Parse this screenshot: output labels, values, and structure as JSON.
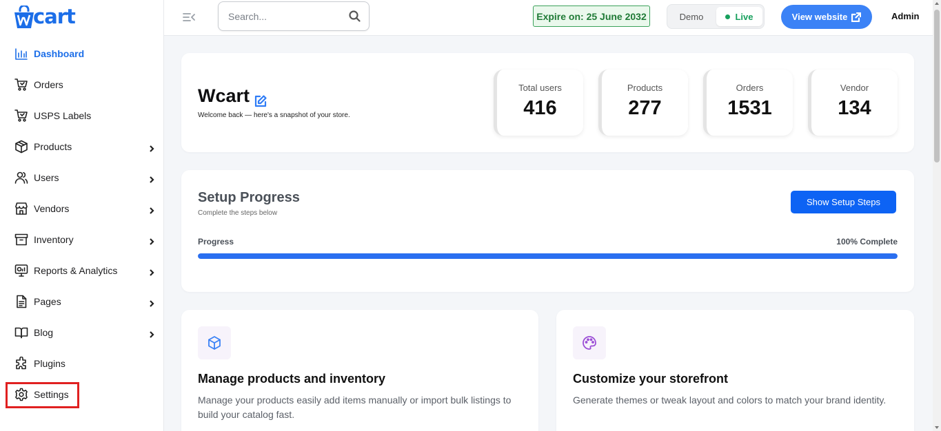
{
  "brand": {
    "name": "cart",
    "accent": "#1c6ee8"
  },
  "sidebar": {
    "items": [
      {
        "label": "Dashboard",
        "icon": "bar-chart-icon",
        "active": true,
        "has_submenu": false
      },
      {
        "label": "Orders",
        "icon": "cart-icon",
        "active": false,
        "has_submenu": false
      },
      {
        "label": "USPS Labels",
        "icon": "cart-icon",
        "active": false,
        "has_submenu": false
      },
      {
        "label": "Products",
        "icon": "box-icon",
        "active": false,
        "has_submenu": true
      },
      {
        "label": "Users",
        "icon": "users-icon",
        "active": false,
        "has_submenu": true
      },
      {
        "label": "Vendors",
        "icon": "store-icon",
        "active": false,
        "has_submenu": true
      },
      {
        "label": "Inventory",
        "icon": "archive-icon",
        "active": false,
        "has_submenu": true
      },
      {
        "label": "Reports & Analytics",
        "icon": "monitor-chart-icon",
        "active": false,
        "has_submenu": true
      },
      {
        "label": "Pages",
        "icon": "document-icon",
        "active": false,
        "has_submenu": true
      },
      {
        "label": "Blog",
        "icon": "book-icon",
        "active": false,
        "has_submenu": true
      },
      {
        "label": "Plugins",
        "icon": "puzzle-icon",
        "active": false,
        "has_submenu": false
      },
      {
        "label": "Settings",
        "icon": "gear-icon",
        "active": false,
        "has_submenu": false
      }
    ]
  },
  "topbar": {
    "search_placeholder": "Search...",
    "expire_text": "Expire on: 25 June 2032",
    "mode_demo": "Demo",
    "mode_live": "Live",
    "view_website": "View website",
    "user": "Admin"
  },
  "welcome": {
    "title": "Wcart",
    "subtitle": "Welcome back — here's a snapshot of your store.",
    "stats": [
      {
        "label": "Total users",
        "value": "416"
      },
      {
        "label": "Products",
        "value": "277"
      },
      {
        "label": "Orders",
        "value": "1531"
      },
      {
        "label": "Vendor",
        "value": "134"
      }
    ]
  },
  "setup": {
    "title": "Setup Progress",
    "subtitle": "Complete the steps below",
    "button": "Show Setup Steps",
    "progress_label": "Progress",
    "progress_text": "100% Complete",
    "progress_fraction": 1.0
  },
  "features": [
    {
      "icon": "cube-icon",
      "icon_color": "#3b82f6",
      "title": "Manage products and inventory",
      "description": "Manage your products easily add items manually or import bulk listings to build your catalog fast."
    },
    {
      "icon": "palette-icon",
      "icon_color": "#9b4dd6",
      "title": "Customize your storefront",
      "description": "Generate themes or tweak layout and colors to match your brand identity."
    }
  ]
}
